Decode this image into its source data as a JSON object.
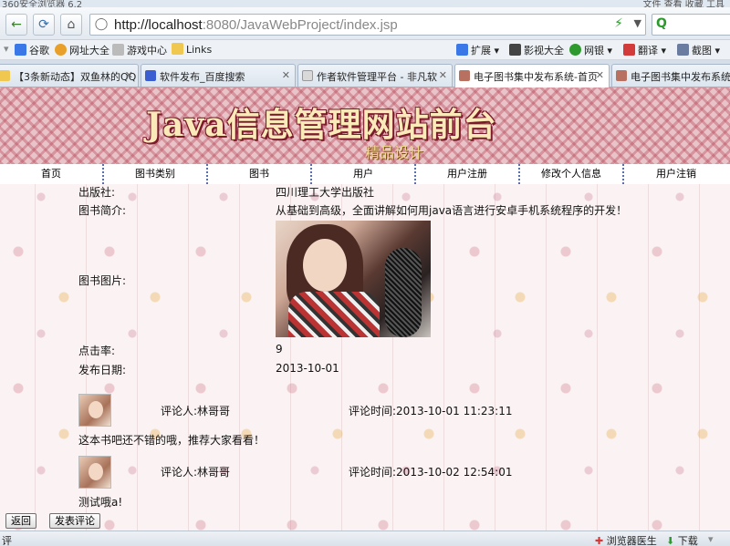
{
  "browser": {
    "title": "360安全浏览器 6.2",
    "top_right": "文件  查看  收藏  工具",
    "url_host": "http://localhost",
    "url_rest": ":8080/JavaWebProject/index.jsp",
    "bookmarks": [
      {
        "label": "谷歌",
        "color": "#3b78e7"
      },
      {
        "label": "网址大全",
        "color": "#e8a02a"
      },
      {
        "label": "游戏中心",
        "color": "#d8d8d8"
      },
      {
        "label": "Links",
        "color": "#f0c850"
      }
    ],
    "bookmarks_right": [
      {
        "label": "扩展",
        "color": "#3b78e7"
      },
      {
        "label": "影视大全",
        "color": "#444444"
      },
      {
        "label": "网银",
        "color": "#2e9a2e"
      },
      {
        "label": "翻译",
        "color": "#d33a3a"
      },
      {
        "label": "截图",
        "color": "#6a7ca0"
      }
    ],
    "tabs": [
      {
        "label": "【3条新动态】双鱼林的QQ",
        "color": "#f0c850"
      },
      {
        "label": "软件发布_百度搜索",
        "color": "#3b5fd0"
      },
      {
        "label": "作者软件管理平台 - 非凡软",
        "color": "#d9d9d9"
      },
      {
        "label": "电子图书集中发布系统-首页",
        "color": "#b87060"
      },
      {
        "label": "电子图书集中发布系统-图",
        "color": "#b87060"
      }
    ],
    "status_left": "评",
    "status_right": [
      "浏览器医生",
      "下载"
    ]
  },
  "site": {
    "title": "Java信息管理网站前台",
    "subtitle": "精品设计",
    "menu": [
      "首页",
      "图书类别",
      "图书",
      "用户",
      "用户注册",
      "修改个人信息",
      "用户注销"
    ]
  },
  "book": {
    "publisher_label": "出版社:",
    "publisher": "四川理工大学出版社",
    "intro_label": "图书简介:",
    "intro": "从基础到高级，全面讲解如何用java语言进行安卓手机系统程序的开发！",
    "image_label": "图书图片:",
    "clicks_label": "点击率:",
    "clicks": "9",
    "date_label": "发布日期:",
    "date": "2013-10-01"
  },
  "comments": [
    {
      "user": "评论人:林哥哥",
      "time": "评论时间:2013-10-01 11:23:11",
      "text": "这本书吧还不错的哦，推荐大家看看！"
    },
    {
      "user": "评论人:林哥哥",
      "time": "评论时间:2013-10-02 12:54:01",
      "text": "测试哦a!"
    }
  ],
  "buttons": {
    "back": "返回",
    "comment": "发表评论"
  }
}
